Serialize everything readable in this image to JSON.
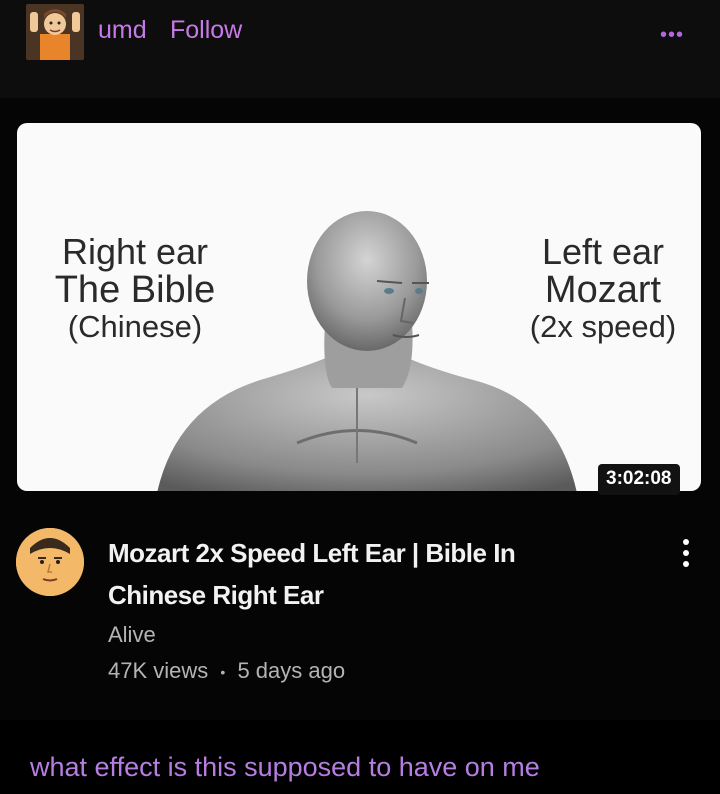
{
  "post": {
    "username": "umd",
    "follow_label": "Follow",
    "more_icon": "•••",
    "caption": "what effect is this supposed to have on me"
  },
  "video": {
    "thumbnail": {
      "left_line1": "Right ear",
      "left_line2": "The Bible",
      "left_line3": "(Chinese)",
      "right_line1": "Left ear",
      "right_line2": "Mozart",
      "right_line3": "(2x speed)",
      "duration": "3:02:08"
    },
    "title_line1": "Mozart 2x Speed Left Ear | Bible In",
    "title_line2": "Chinese Right Ear",
    "channel": "Alive",
    "views": "47K views",
    "separator": "•",
    "age": "5 days ago"
  },
  "colors": {
    "accent": "#c879e8",
    "caption": "#b67ee0",
    "background": "#000000"
  }
}
